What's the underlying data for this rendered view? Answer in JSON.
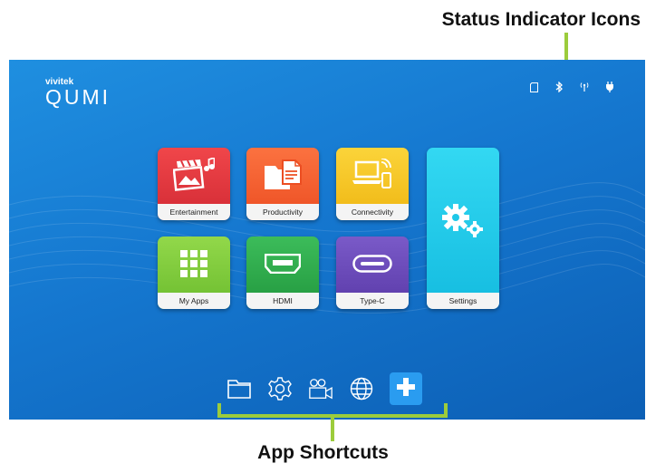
{
  "callouts": {
    "status_title": "Status Indicator Icons",
    "shortcuts_title": "App Shortcuts"
  },
  "logo": {
    "brand": "vivitek",
    "product": "QUMI"
  },
  "status_icons": [
    "sd-card-icon",
    "bluetooth-icon",
    "wifi-antenna-icon",
    "power-plug-icon"
  ],
  "tiles": [
    {
      "label": "Entertainment",
      "color": "#e0343c",
      "icon": "media-icon"
    },
    {
      "label": "Productivity",
      "color": "#f25c2c",
      "icon": "documents-icon"
    },
    {
      "label": "Connectivity",
      "color": "#f2c21a",
      "icon": "computer-phone-icon"
    },
    {
      "label": "My Apps",
      "color": "#7cc83a",
      "icon": "grid-icon"
    },
    {
      "label": "HDMI",
      "color": "#2ca84a",
      "icon": "hdmi-port-icon"
    },
    {
      "label": "Type-C",
      "color": "#6a4ab8",
      "icon": "usb-c-port-icon"
    },
    {
      "label": "Settings",
      "color": "#1fc8e8",
      "icon": "gears-icon"
    }
  ],
  "shortcuts": [
    "folder-icon",
    "gear-icon",
    "video-camera-icon",
    "globe-icon",
    "add-icon"
  ],
  "colors": {
    "accent_green": "#9ccc3c",
    "screen_blue": "#1577cf",
    "add_button": "#2a9cf0"
  }
}
